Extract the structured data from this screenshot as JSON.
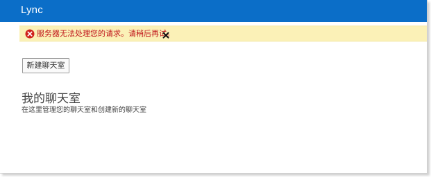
{
  "app": {
    "title": "Lync"
  },
  "alert": {
    "message": "服务器无法处理您的请求。请稍后再试。",
    "icon": "error-icon",
    "close_icon": "close-icon",
    "background_color": "#fbf1b7",
    "text_color": "#c0141a"
  },
  "toolbar": {
    "new_room_label": "新建聊天室"
  },
  "main": {
    "heading": "我的聊天室",
    "subtitle": "在这里管理您的聊天室和创建新的聊天室"
  },
  "theme": {
    "titlebar_color": "#0b6ec8"
  }
}
